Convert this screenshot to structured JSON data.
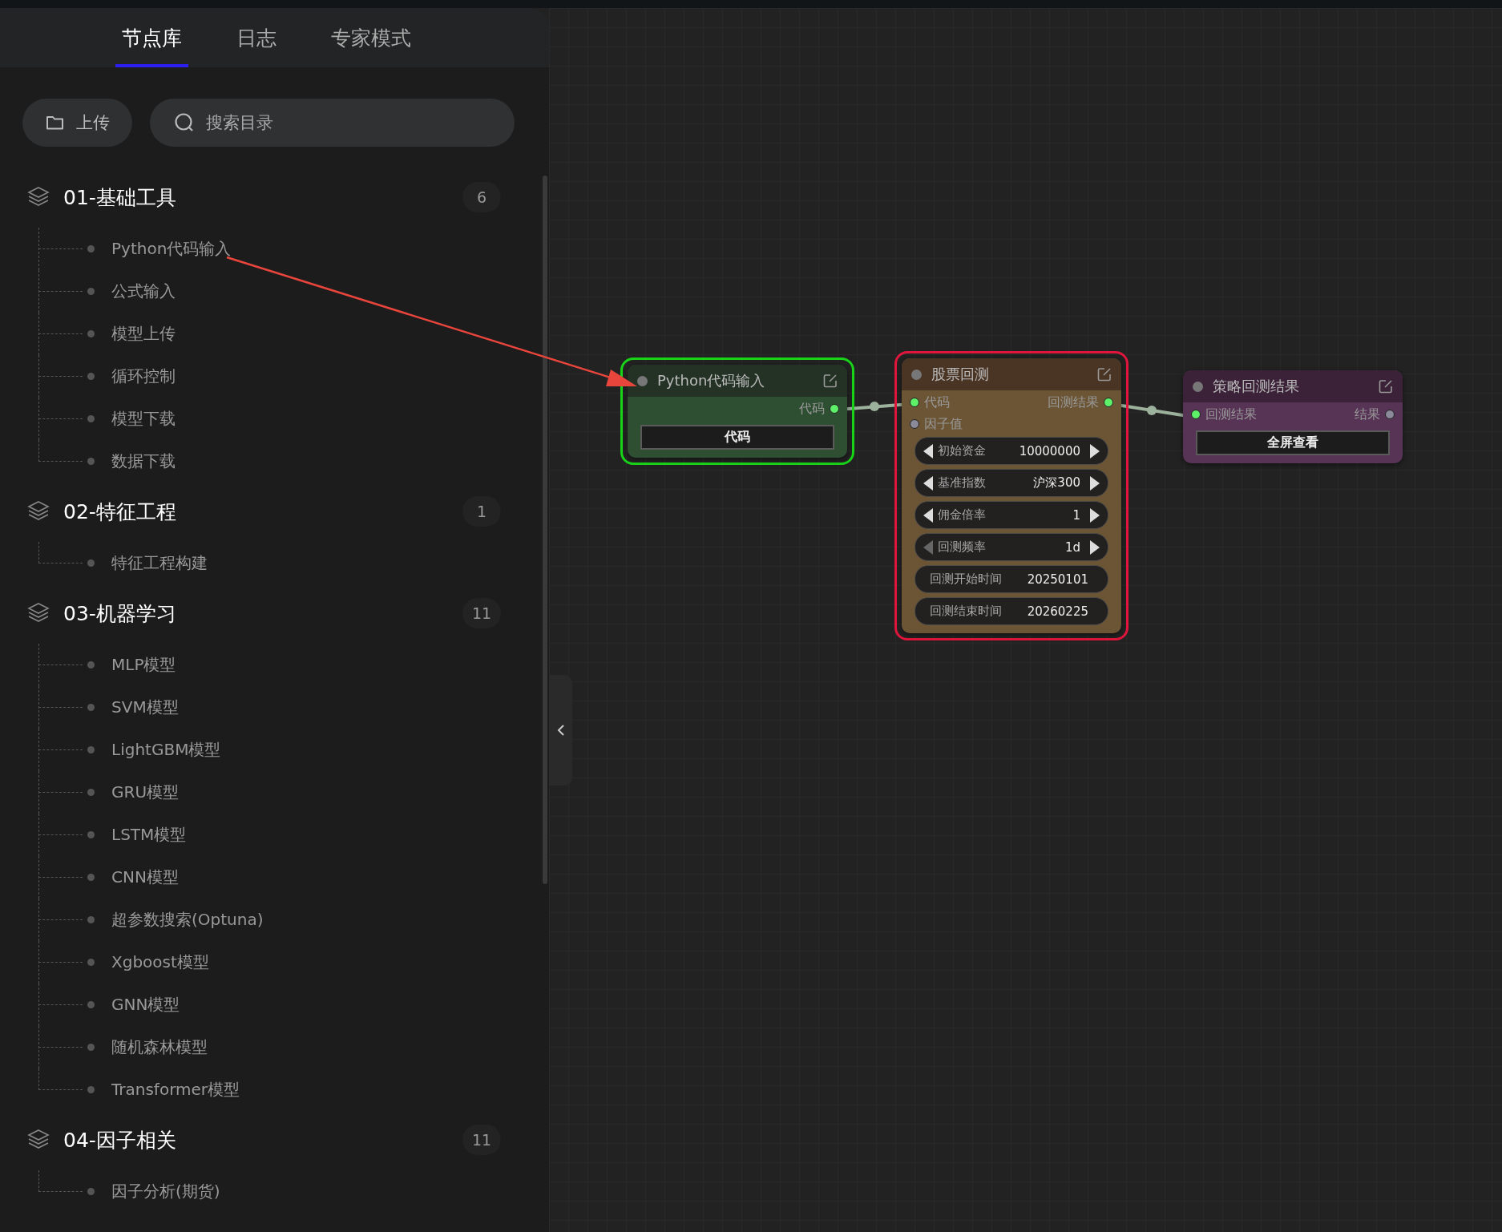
{
  "tabs": [
    {
      "label": "节点库",
      "selected": true
    },
    {
      "label": "日志",
      "selected": false
    },
    {
      "label": "专家模式",
      "selected": false
    }
  ],
  "toolbar": {
    "upload_button": "上传",
    "search": {
      "placeholder": "搜索目录"
    }
  },
  "groups": [
    {
      "title": "01-基础工具",
      "count": "6",
      "children": [
        {
          "label": "Python代码输入"
        },
        {
          "label": "公式输入"
        },
        {
          "label": "模型上传"
        },
        {
          "label": "循环控制"
        },
        {
          "label": "模型下载"
        },
        {
          "label": "数据下载"
        }
      ]
    },
    {
      "title": "02-特征工程",
      "count": "1",
      "children": [
        {
          "label": "特征工程构建"
        }
      ]
    },
    {
      "title": "03-机器学习",
      "count": "11",
      "children": [
        {
          "label": "MLP模型"
        },
        {
          "label": "SVM模型"
        },
        {
          "label": "LightGBM模型"
        },
        {
          "label": "GRU模型"
        },
        {
          "label": "LSTM模型"
        },
        {
          "label": "CNN模型"
        },
        {
          "label": "超参数搜索(Optuna)"
        },
        {
          "label": "Xgboost模型"
        },
        {
          "label": "GNN模型"
        },
        {
          "label": "随机森林模型"
        },
        {
          "label": "Transformer模型"
        }
      ]
    },
    {
      "title": "04-因子相关",
      "count": "11",
      "children": [
        {
          "label": "因子分析(期货)"
        }
      ]
    }
  ],
  "canvas": {
    "nodes": [
      {
        "kind": "input",
        "title": "Python代码输入",
        "color": "#19d319",
        "outputs": [
          {
            "label": "代码",
            "connected": true
          }
        ],
        "widgets": [
          {
            "kind": "button",
            "label": "代码"
          }
        ]
      },
      {
        "kind": "backtest",
        "title": "股票回测",
        "color": "#e0163c",
        "inputs": [
          {
            "label": "代码",
            "connected": true
          },
          {
            "label": "因子值",
            "connected": false
          }
        ],
        "outputs": [
          {
            "label": "回测结果",
            "connected": true
          }
        ],
        "widgets": [
          {
            "kind": "stepper",
            "label": "初始资金",
            "value": "10000000",
            "prev_disabled": false
          },
          {
            "kind": "stepper",
            "label": "基准指数",
            "value": "沪深300",
            "prev_disabled": false
          },
          {
            "kind": "stepper",
            "label": "佣金倍率",
            "value": "1",
            "prev_disabled": false
          },
          {
            "kind": "stepper",
            "label": "回测频率",
            "value": "1d",
            "prev_disabled": true
          },
          {
            "kind": "field",
            "label": "回测开始时间",
            "value": "20250101"
          },
          {
            "kind": "field",
            "label": "回测结束时间",
            "value": "20260225"
          }
        ]
      },
      {
        "kind": "result",
        "title": "策略回测结果",
        "inputs": [
          {
            "label": "回测结果",
            "connected": true
          }
        ],
        "outputs": [
          {
            "label": "结果",
            "connected": false
          }
        ],
        "widgets": [
          {
            "kind": "button",
            "label": "全屏查看"
          }
        ]
      }
    ]
  }
}
